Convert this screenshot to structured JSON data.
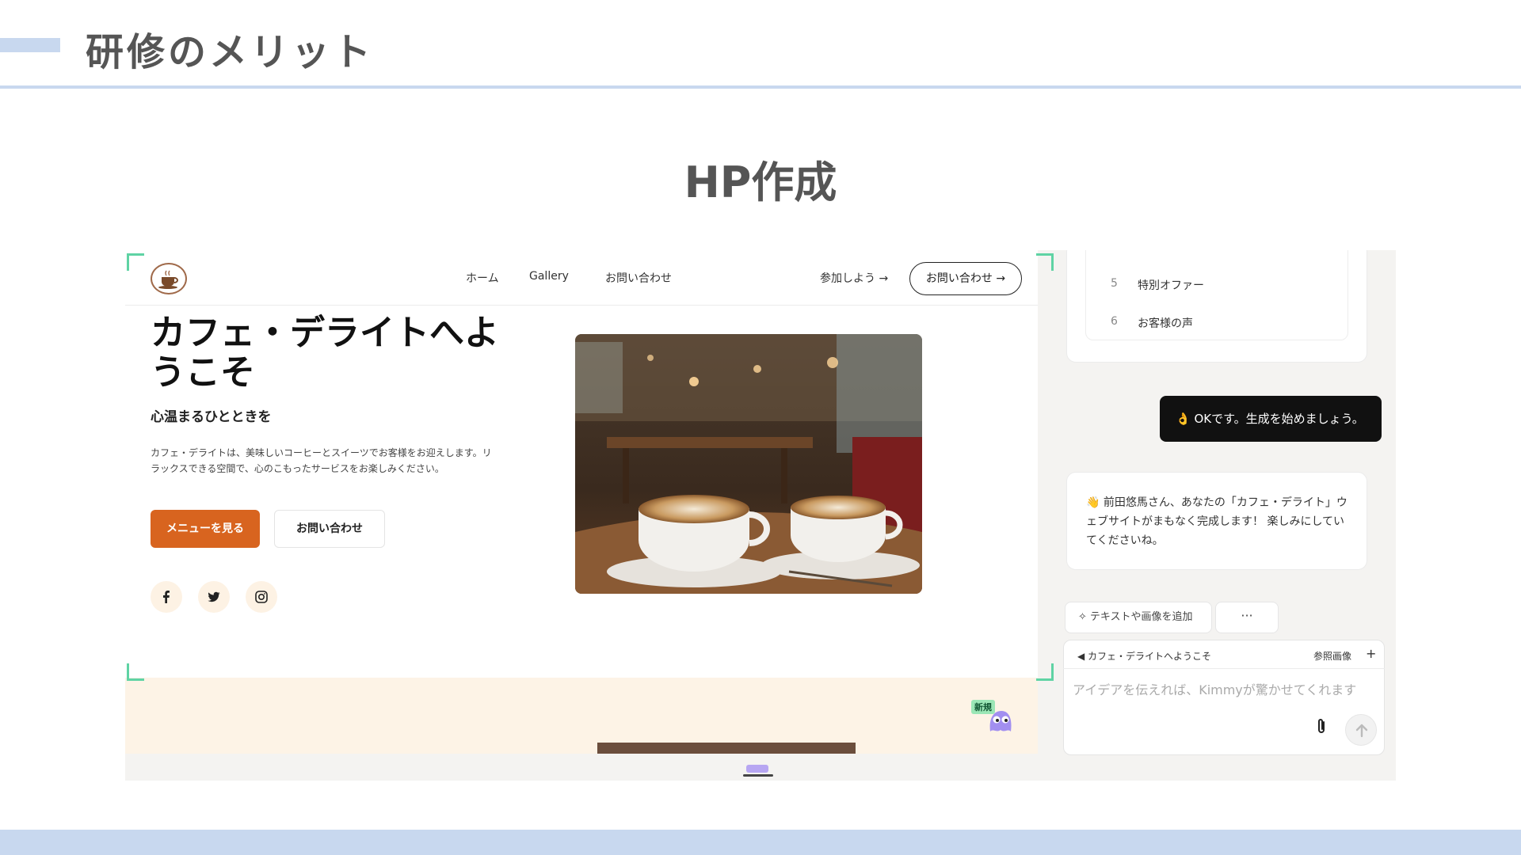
{
  "slide": {
    "title": "研修のメリット",
    "subtitle": "HP作成"
  },
  "site": {
    "nav": {
      "links": [
        "ホーム",
        "Gallery",
        "お問い合わせ"
      ],
      "join": "参加しよう →",
      "cta": "お問い合わせ →"
    },
    "hero": {
      "title": "カフェ・デライトへようこそ",
      "tagline": "心温まるひとときを",
      "description": "カフェ・デライトは、美味しいコーヒーとスイーツでお客様をお迎えします。リラックスできる空間で、心のこもったサービスをお楽しみください。",
      "primary_button": "メニューを見る",
      "secondary_button": "お問い合わせ"
    },
    "social_icons": [
      "facebook-icon",
      "twitter-icon",
      "instagram-icon"
    ],
    "badge": "新規",
    "accent_color": "#d8641f"
  },
  "chat": {
    "outline": [
      {
        "num": "5",
        "text": "特別オファー"
      },
      {
        "num": "6",
        "text": "お客様の声"
      }
    ],
    "user_message": "👌 OKです。生成を始めましょう。",
    "assistant_message": "👋 前田悠馬さん、あなたの「カフェ・デライト」ウェブサイトがまもなく完成します！ 楽しみにしていてくださいね。",
    "add_button": "テキストや画像を追加",
    "more_button": "···",
    "composer": {
      "context": "カフェ・デライトへようこそ",
      "reference": "参照画像",
      "plus": "+",
      "placeholder": "アイデアを伝えれば、Kimmyが驚かせてくれます"
    }
  }
}
